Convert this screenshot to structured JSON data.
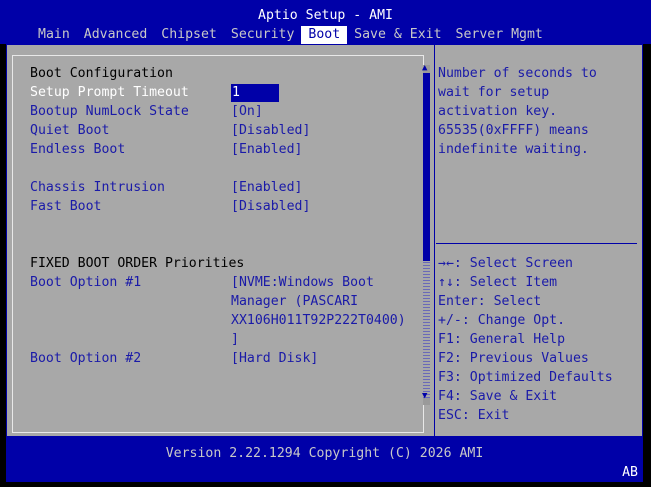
{
  "title": "Aptio Setup - AMI",
  "tabs": [
    "Main",
    "Advanced",
    "Chipset",
    "Security",
    "Boot",
    "Save & Exit",
    "Server Mgmt"
  ],
  "active_tab": "Boot",
  "left": {
    "section1": "Boot Configuration",
    "items": [
      {
        "label": "Setup Prompt Timeout",
        "value": "1"
      },
      {
        "label": "Bootup NumLock State",
        "value": "[On]"
      },
      {
        "label": "Quiet Boot",
        "value": "[Disabled]"
      },
      {
        "label": "Endless Boot",
        "value": "[Enabled]"
      },
      {
        "label": "Chassis Intrusion",
        "value": "[Enabled]"
      },
      {
        "label": "Fast Boot",
        "value": "[Disabled]"
      }
    ],
    "section2": "FIXED BOOT ORDER Priorities",
    "boot1": {
      "label": "Boot Option #1",
      "value_lines": [
        "[NVME:Windows Boot",
        "Manager (PASCARI",
        "XX106H011T92P222T0400)",
        "]"
      ]
    },
    "boot2": {
      "label": "Boot Option #2",
      "value": "[Hard Disk]"
    }
  },
  "help": [
    "Number of seconds to",
    "wait for setup",
    "activation key.",
    "65535(0xFFFF) means",
    "indefinite waiting."
  ],
  "keys": [
    "→←: Select Screen",
    "↑↓: Select Item",
    "Enter: Select",
    "+/-: Change Opt.",
    "F1: General Help",
    "F2: Previous Values",
    "F3: Optimized Defaults",
    "F4: Save & Exit",
    "ESC: Exit"
  ],
  "footer": {
    "version": "Version 2.22.1294 Copyright (C) 2026 AMI",
    "badge": "AB"
  },
  "scroll_arrows": {
    "up": "▲",
    "down": "▼"
  }
}
